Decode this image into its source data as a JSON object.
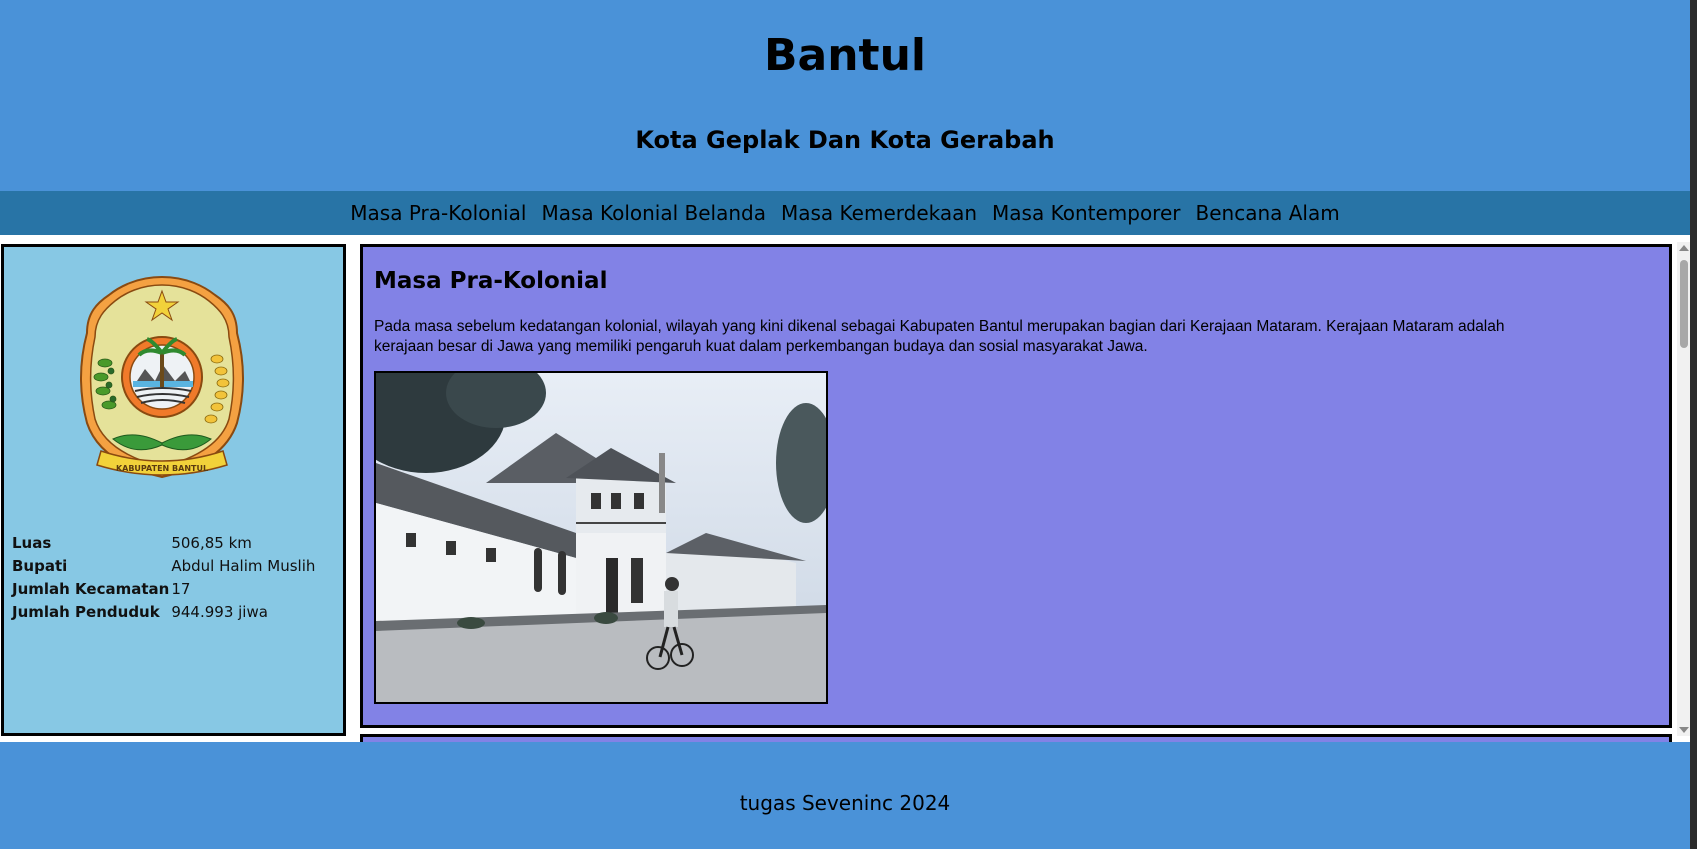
{
  "header": {
    "title": "Bantul",
    "subtitle": "Kota Geplak Dan Kota Gerabah"
  },
  "nav": {
    "items": [
      {
        "label": "Masa Pra-Kolonial"
      },
      {
        "label": "Masa Kolonial Belanda"
      },
      {
        "label": "Masa Kemerdekaan"
      },
      {
        "label": "Masa Kontemporer"
      },
      {
        "label": "Bencana Alam"
      }
    ]
  },
  "sidebar": {
    "logo_text": "KABUPATEN BANTUL",
    "info": [
      {
        "key": "Luas",
        "value": "506,85 km"
      },
      {
        "key": "Bupati",
        "value": "Abdul Halim Muslih"
      },
      {
        "key": "Jumlah Kecamatan",
        "value": "17"
      },
      {
        "key": "Jumlah Penduduk",
        "value": "944.993 jiwa"
      }
    ]
  },
  "main": {
    "section_title": "Masa Pra-Kolonial",
    "paragraph": "Pada masa sebelum kedatangan kolonial, wilayah yang kini dikenal sebagai Kabupaten Bantul merupakan bagian dari Kerajaan Mataram. Kerajaan Mataram adalah kerajaan besar di Jawa yang memiliki pengaruh kuat dalam perkembangan budaya dan sosial masyarakat Jawa."
  },
  "footer": {
    "text": "tugas Seveninc 2024"
  },
  "colors": {
    "header_bg": "#4a92d8",
    "nav_bg": "#2874a6",
    "sidebar_bg": "#87c8e4",
    "main_bg": "#8282e6"
  }
}
